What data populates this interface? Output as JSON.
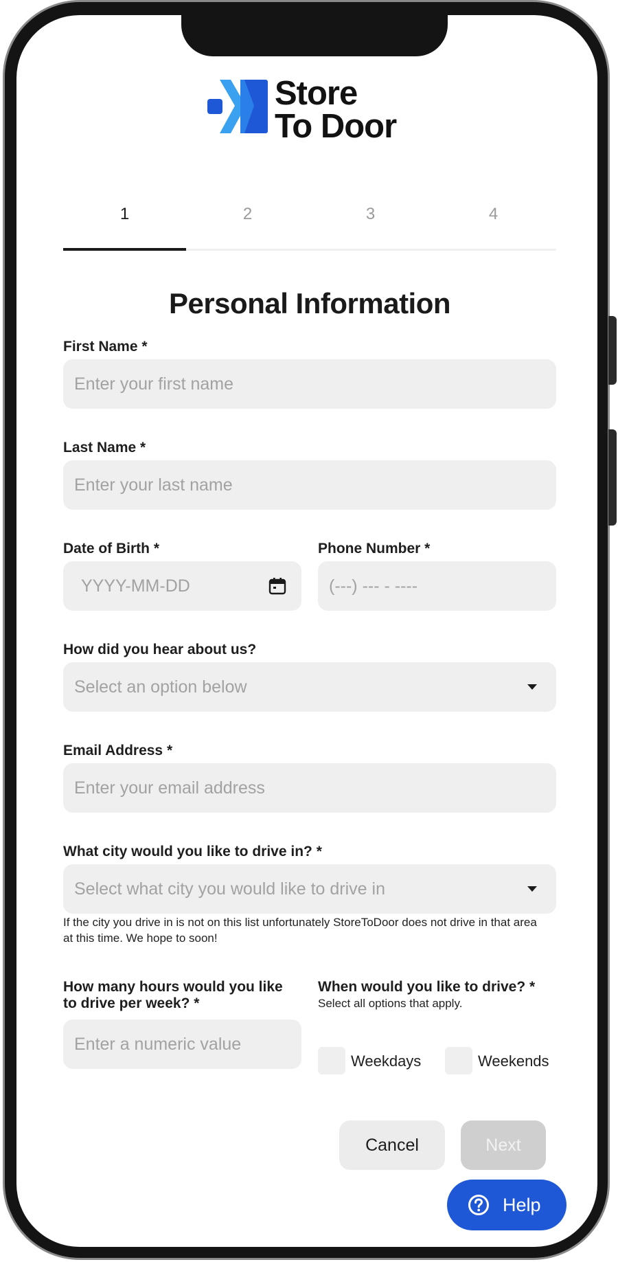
{
  "brand": {
    "name_line1": "Store",
    "name_line2": "To Door",
    "colors": {
      "primary": "#1f58d6",
      "light": "#3aa0f0"
    }
  },
  "stepper": {
    "steps": [
      "1",
      "2",
      "3",
      "4"
    ],
    "active_index": 0
  },
  "form": {
    "title": "Personal Information",
    "first_name": {
      "label": "First Name *",
      "placeholder": "Enter your first name",
      "value": ""
    },
    "last_name": {
      "label": "Last Name *",
      "placeholder": "Enter your last name",
      "value": ""
    },
    "dob": {
      "label": "Date of Birth *",
      "placeholder": "YYYY-MM-DD",
      "value": ""
    },
    "phone": {
      "label": "Phone Number *",
      "placeholder": "(---) --- - ----",
      "value": ""
    },
    "referral": {
      "label": "How did you hear about us?",
      "placeholder": "Select an option below"
    },
    "email": {
      "label": "Email Address *",
      "placeholder": "Enter your email address",
      "value": ""
    },
    "city": {
      "label": "What city would you like to drive in? *",
      "placeholder": "Select what city you would like to drive in",
      "note": "If the city you drive in is not on this list unfortunately StoreToDoor does not drive in that area at this time. We hope to soon!"
    },
    "hours": {
      "label_line1": "How many hours would you like",
      "label_line2": "to drive per week? *",
      "placeholder": "Enter a numeric value",
      "value": ""
    },
    "schedule": {
      "label": "When would you like to drive? *",
      "sublabel": "Select all options that apply.",
      "options": [
        {
          "label": "Weekdays",
          "checked": false
        },
        {
          "label": "Weekends",
          "checked": false
        }
      ]
    }
  },
  "actions": {
    "cancel_label": "Cancel",
    "next_label": "Next"
  },
  "help": {
    "label": "Help",
    "icon": "help-circle-icon"
  }
}
